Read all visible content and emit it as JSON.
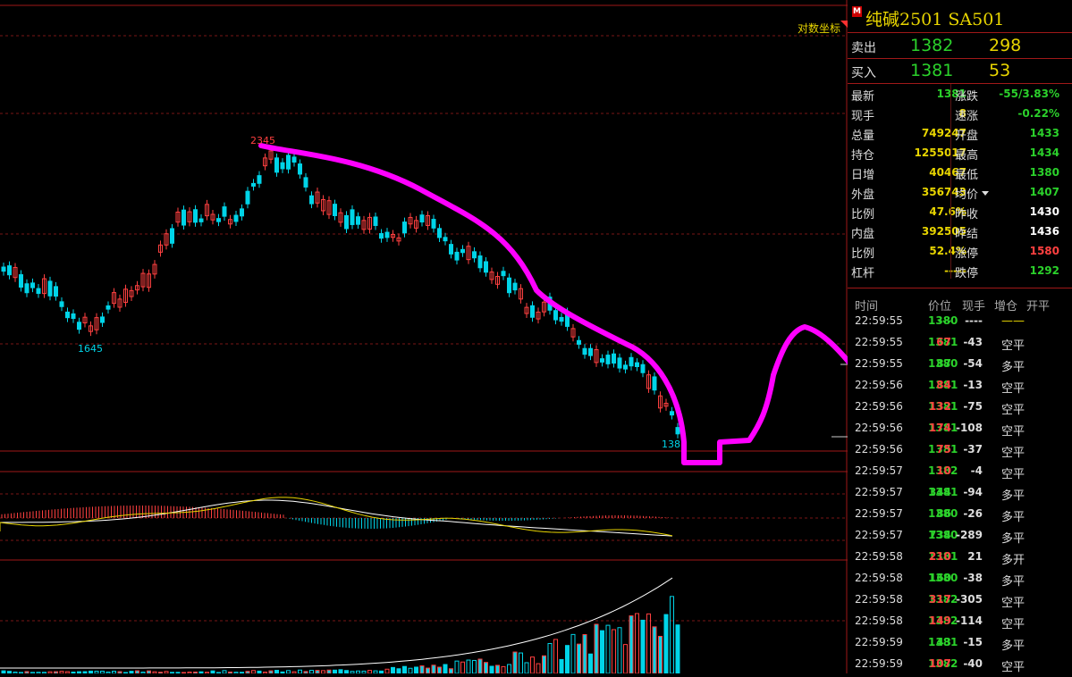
{
  "chart": {
    "scale_label": "对数坐标",
    "high_label": "2345",
    "low_label": "1645",
    "last_label": "138"
  },
  "header": {
    "title": "纯碱2501  SA501",
    "marker": "M"
  },
  "orderbook": {
    "sell": {
      "label": "卖出",
      "price": "1382",
      "volume": "298"
    },
    "buy": {
      "label": "买入",
      "price": "1381",
      "volume": "53"
    }
  },
  "quote": [
    {
      "l1": "最新",
      "v1": "1381",
      "c1": "#2bd12b",
      "l2": "涨跌",
      "v2": "-55/3.83%",
      "c2": "#2bd12b"
    },
    {
      "l1": "现手",
      "v1": "8",
      "c1": "#e8d500",
      "l2": "速涨",
      "v2": "-0.22%",
      "c2": "#2bd12b"
    },
    {
      "l1": "总量",
      "v1": "749247",
      "c1": "#e8d500",
      "l2": "开盘",
      "v2": "1433",
      "c2": "#2bd12b"
    },
    {
      "l1": "持仓",
      "v1": "1255017",
      "c1": "#e8d500",
      "l2": "最高",
      "v2": "1434",
      "c2": "#2bd12b"
    },
    {
      "l1": "日增",
      "v1": "40467",
      "c1": "#e8d500",
      "l2": "最低",
      "v2": "1380",
      "c2": "#2bd12b"
    },
    {
      "l1": "外盘",
      "v1": "356743",
      "c1": "#e8d500",
      "l2": "均价",
      "v2": "1407",
      "c2": "#2bd12b"
    },
    {
      "l1": "比例",
      "v1": "47.6%",
      "c1": "#e8d500",
      "l2": "昨收",
      "v2": "1430",
      "c2": "#ffffff"
    },
    {
      "l1": "内盘",
      "v1": "392505",
      "c1": "#e8d500",
      "l2": "昨结",
      "v2": "1436",
      "c2": "#ffffff"
    },
    {
      "l1": "比例",
      "v1": "52.4%",
      "c1": "#e8d500",
      "l2": "涨停",
      "v2": "1580",
      "c2": "#ff4040"
    },
    {
      "l1": "杠杆",
      "v1": "-----",
      "c1": "#e8d500",
      "l2": "跌停",
      "v2": "1292",
      "c2": "#2bd12b"
    }
  ],
  "ticks_header": {
    "time": "时间",
    "price": "价位",
    "hand": "现手",
    "oi": "增仓",
    "kp": "开平"
  },
  "ticks": [
    {
      "time": "22:59:55",
      "price": "1380",
      "hand": "---",
      "oi": "----",
      "kp": "——",
      "pc": "#2bd12b",
      "hc": "#2bd12b",
      "kc": "#e8d500"
    },
    {
      "time": "22:59:55",
      "price": "1381",
      "hand": "67",
      "oi": "-43",
      "kp": "空平",
      "pc": "#2bd12b",
      "hc": "#ff4040",
      "kc": "#dddddd"
    },
    {
      "time": "22:59:55",
      "price": "1380",
      "hand": "87",
      "oi": "-54",
      "kp": "多平",
      "pc": "#2bd12b",
      "hc": "#2bd12b",
      "kc": "#dddddd"
    },
    {
      "time": "22:59:56",
      "price": "1381",
      "hand": "84",
      "oi": "-13",
      "kp": "空平",
      "pc": "#2bd12b",
      "hc": "#ff4040",
      "kc": "#dddddd"
    },
    {
      "time": "22:59:56",
      "price": "1381",
      "hand": "132",
      "oi": "-75",
      "kp": "空平",
      "pc": "#2bd12b",
      "hc": "#ff4040",
      "kc": "#dddddd"
    },
    {
      "time": "22:59:56",
      "price": "1381",
      "hand": "174",
      "oi": "-108",
      "kp": "空平",
      "pc": "#2bd12b",
      "hc": "#ff4040",
      "kc": "#dddddd"
    },
    {
      "time": "22:59:56",
      "price": "1381",
      "hand": "75",
      "oi": "-37",
      "kp": "空平",
      "pc": "#2bd12b",
      "hc": "#ff4040",
      "kc": "#dddddd"
    },
    {
      "time": "22:59:57",
      "price": "1382",
      "hand": "10",
      "oi": "-4",
      "kp": "空平",
      "pc": "#2bd12b",
      "hc": "#ff4040",
      "kc": "#dddddd"
    },
    {
      "time": "22:59:57",
      "price": "1381",
      "hand": "344",
      "oi": "-94",
      "kp": "多平",
      "pc": "#2bd12b",
      "hc": "#2bd12b",
      "kc": "#dddddd"
    },
    {
      "time": "22:59:57",
      "price": "1380",
      "hand": "86",
      "oi": "-26",
      "kp": "多平",
      "pc": "#2bd12b",
      "hc": "#2bd12b",
      "kc": "#dddddd"
    },
    {
      "time": "22:59:57",
      "price": "1380",
      "hand": "734",
      "oi": "-289",
      "kp": "多平",
      "pc": "#2bd12b",
      "hc": "#2bd12b",
      "kc": "#dddddd"
    },
    {
      "time": "22:59:58",
      "price": "1381",
      "hand": "210",
      "oi": "21",
      "kp": "多开",
      "pc": "#2bd12b",
      "hc": "#ff4040",
      "kc": "#dddddd"
    },
    {
      "time": "22:59:58",
      "price": "1380",
      "hand": "160",
      "oi": "-38",
      "kp": "多平",
      "pc": "#2bd12b",
      "hc": "#2bd12b",
      "kc": "#dddddd"
    },
    {
      "time": "22:59:58",
      "price": "1382",
      "hand": "317",
      "oi": "-305",
      "kp": "空平",
      "pc": "#2bd12b",
      "hc": "#ff4040",
      "kc": "#dddddd"
    },
    {
      "time": "22:59:58",
      "price": "1382",
      "hand": "149",
      "oi": "-114",
      "kp": "空平",
      "pc": "#2bd12b",
      "hc": "#ff4040",
      "kc": "#dddddd"
    },
    {
      "time": "22:59:59",
      "price": "1381",
      "hand": "43",
      "oi": "-15",
      "kp": "多平",
      "pc": "#2bd12b",
      "hc": "#2bd12b",
      "kc": "#dddddd"
    },
    {
      "time": "22:59:59",
      "price": "1382",
      "hand": "107",
      "oi": "-40",
      "kp": "空平",
      "pc": "#2bd12b",
      "hc": "#ff4040",
      "kc": "#dddddd"
    }
  ],
  "colors": {
    "up": "#ff4040",
    "down": "#00d4e8",
    "grid": "#8a1a1a",
    "annotation": "#ff00ff"
  }
}
